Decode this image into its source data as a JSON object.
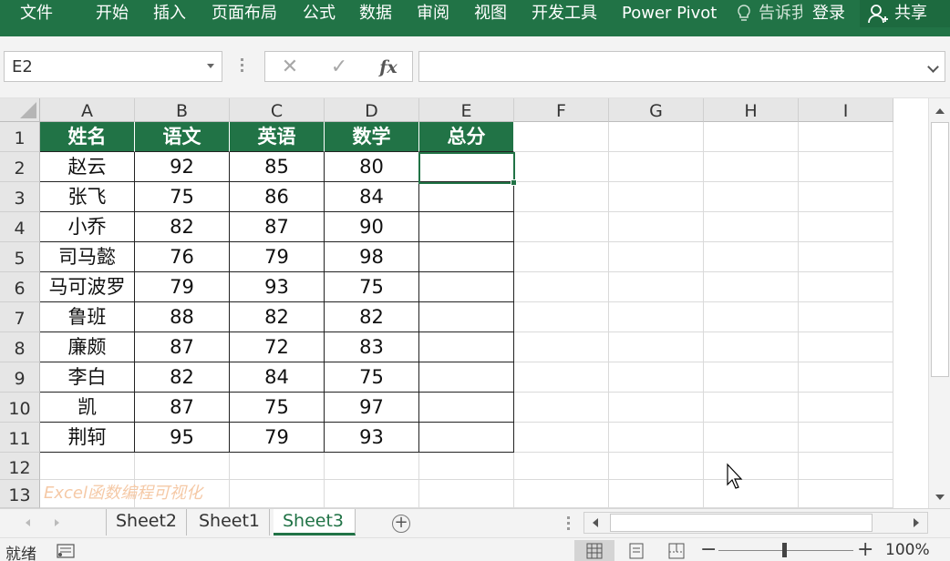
{
  "ribbon": {
    "tabs": [
      "文件",
      "开始",
      "插入",
      "页面布局",
      "公式",
      "数据",
      "审阅",
      "视图",
      "开发工具",
      "Power Pivot"
    ],
    "tell_me": "告诉我",
    "login": "登录",
    "share": "共享"
  },
  "formula_bar": {
    "name_box": "E2",
    "cancel": "✕",
    "enter": "✓",
    "fx": "fx",
    "content": ""
  },
  "grid": {
    "columns": [
      "A",
      "B",
      "C",
      "D",
      "E",
      "F",
      "G",
      "H",
      "I"
    ],
    "rows": [
      "1",
      "2",
      "3",
      "4",
      "5",
      "6",
      "7",
      "8",
      "9",
      "10",
      "11",
      "12",
      "13"
    ],
    "headers": [
      "姓名",
      "语文",
      "英语",
      "数学",
      "总分"
    ],
    "data": [
      [
        "赵云",
        "92",
        "85",
        "80",
        ""
      ],
      [
        "张飞",
        "75",
        "86",
        "84",
        ""
      ],
      [
        "小乔",
        "82",
        "87",
        "90",
        ""
      ],
      [
        "司马懿",
        "76",
        "79",
        "98",
        ""
      ],
      [
        "马可波罗",
        "79",
        "93",
        "75",
        ""
      ],
      [
        "鲁班",
        "88",
        "82",
        "82",
        ""
      ],
      [
        "廉颇",
        "87",
        "72",
        "83",
        ""
      ],
      [
        "李白",
        "82",
        "84",
        "75",
        ""
      ],
      [
        "凯",
        "87",
        "75",
        "97",
        ""
      ],
      [
        "荆轲",
        "95",
        "79",
        "93",
        ""
      ]
    ],
    "selected_cell": "E2",
    "watermark": "Excel函数编程可视化"
  },
  "sheets": {
    "tabs": [
      "Sheet2",
      "Sheet1",
      "Sheet3"
    ],
    "active": "Sheet3"
  },
  "status": {
    "ready": "就绪",
    "zoom": "100%"
  },
  "colors": {
    "accent": "#217346",
    "grid_line": "#dadada",
    "header_bg": "#e6e6e6"
  }
}
